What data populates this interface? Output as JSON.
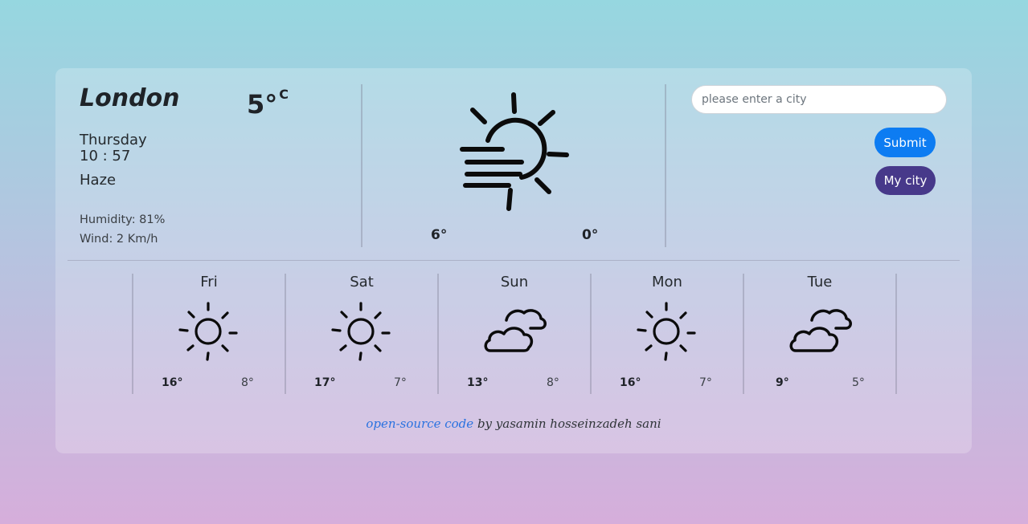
{
  "current": {
    "city": "London",
    "temperature": "5°",
    "unit": "C",
    "day": "Thursday",
    "time": "10 : 57",
    "description": "Haze",
    "humidity": "Humidity: 81%",
    "wind": "Wind: 2 Km/h",
    "high": "6°",
    "low": "0°",
    "icon": "haze-icon"
  },
  "search": {
    "placeholder": "please enter a city",
    "value": ""
  },
  "buttons": {
    "submit": "Submit",
    "my_city": "My city"
  },
  "forecast": [
    {
      "day": "Fri",
      "icon": "sun-icon",
      "high": "16°",
      "low": "8°"
    },
    {
      "day": "Sat",
      "icon": "sun-icon",
      "high": "17°",
      "low": "7°"
    },
    {
      "day": "Sun",
      "icon": "clouds-icon",
      "high": "13°",
      "low": "8°"
    },
    {
      "day": "Mon",
      "icon": "sun-icon",
      "high": "16°",
      "low": "7°"
    },
    {
      "day": "Tue",
      "icon": "clouds-icon",
      "high": "9°",
      "low": "5°"
    }
  ],
  "footer": {
    "link_text": "open-source code",
    "credit": " by yasamin hosseinzadeh sani"
  },
  "colors": {
    "submit": "#0d7cf2",
    "my_city": "#47398a",
    "link": "#2a72e0"
  }
}
